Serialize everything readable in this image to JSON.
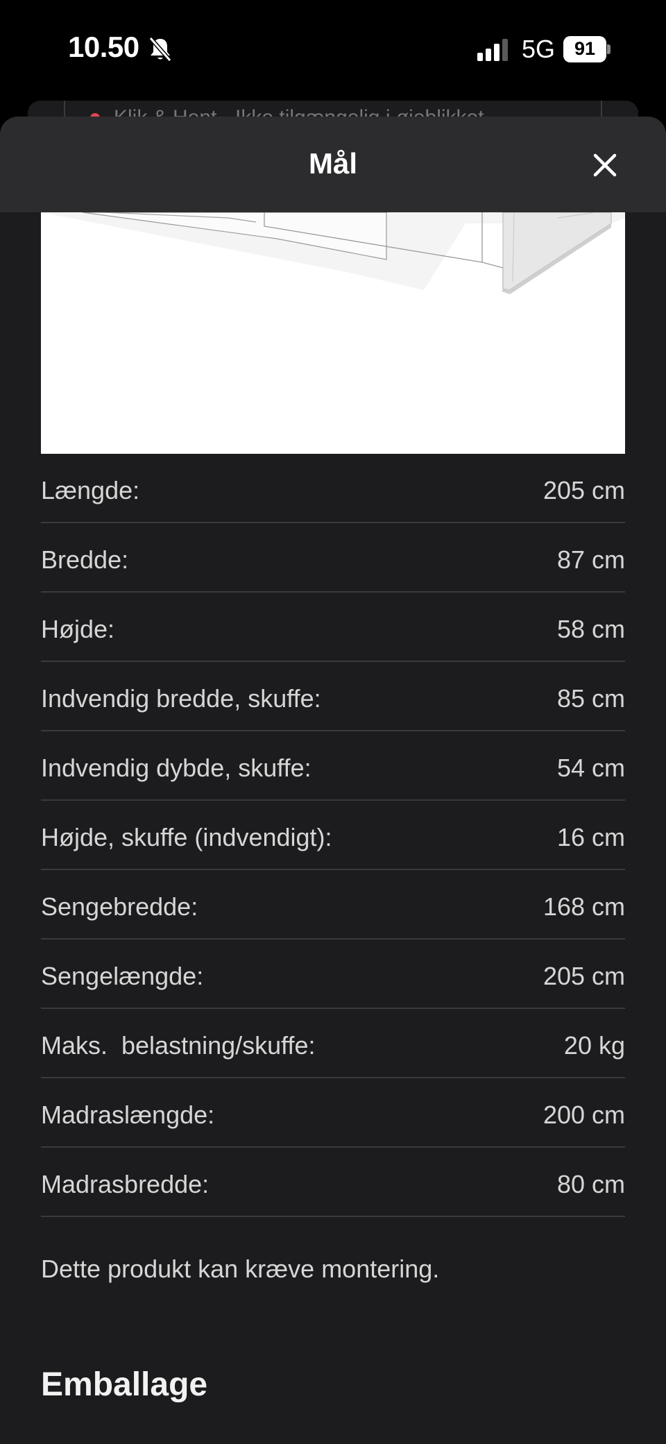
{
  "status_bar": {
    "time": "10.50",
    "network": "5G",
    "battery": "91",
    "icons": [
      "bell-slash-icon",
      "signal-bars-icon",
      "battery-icon"
    ]
  },
  "background_page": {
    "availability_text": "Klik & Hent - Ikke tilgængelig i øjeblikket",
    "status_color": "#e0464e"
  },
  "sheet": {
    "title": "Mål",
    "close_icon": "close-icon"
  },
  "dimensions": [
    {
      "label": "Længde:",
      "value": "205 cm"
    },
    {
      "label": "Bredde:",
      "value": "87 cm"
    },
    {
      "label": "Højde:",
      "value": "58 cm"
    },
    {
      "label": "Indvendig bredde, skuffe:",
      "value": "85 cm"
    },
    {
      "label": "Indvendig dybde, skuffe:",
      "value": "54 cm"
    },
    {
      "label": "Højde, skuffe (indvendigt):",
      "value": "16 cm"
    },
    {
      "label": "Sengebredde:",
      "value": "168 cm"
    },
    {
      "label": "Sengelængde:",
      "value": "205 cm"
    },
    {
      "label": "Maks.  belastning/skuffe:",
      "value": "20 kg"
    },
    {
      "label": "Madraslængde:",
      "value": "200 cm"
    },
    {
      "label": "Madrasbredde:",
      "value": "80 cm"
    }
  ],
  "assembly_note": "Dette produkt kan kræve montering.",
  "packaging_heading": "Emballage"
}
